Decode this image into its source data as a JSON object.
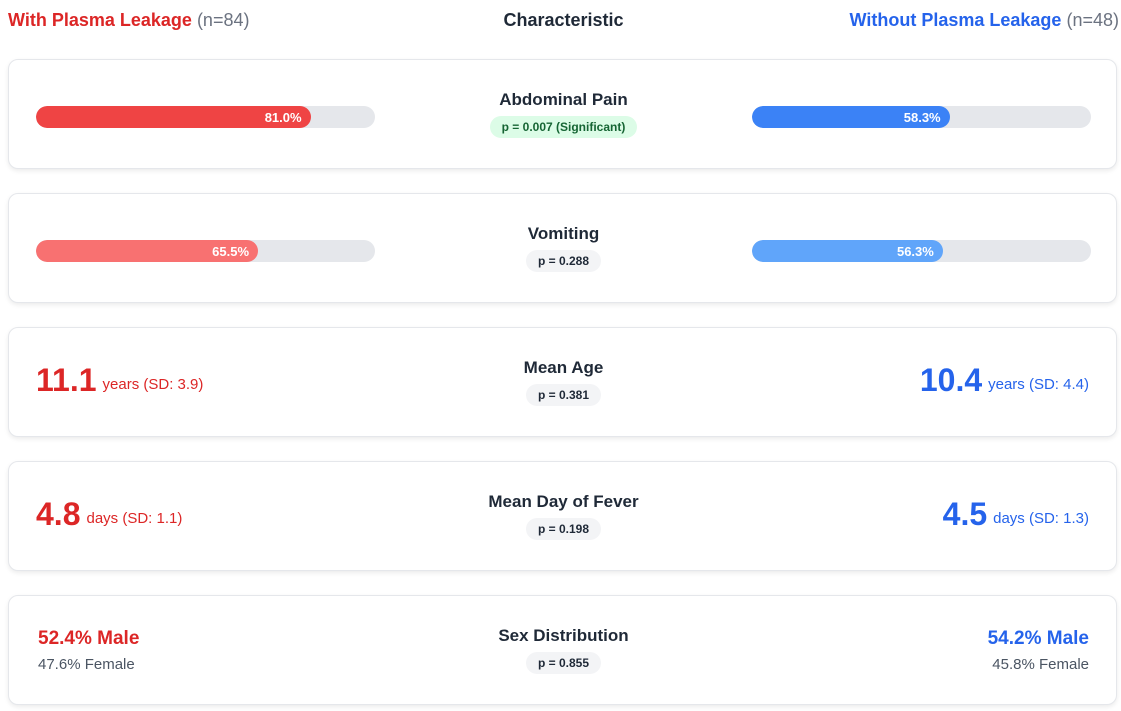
{
  "header": {
    "left_group": "With Plasma Leakage",
    "left_n": "(n=84)",
    "center": "Characteristic",
    "right_group": "Without Plasma Leakage",
    "right_n": "(n=48)"
  },
  "colors": {
    "left_strong": "#ef4444",
    "left_light": "#f87171",
    "left_text": "#dc2626",
    "right_strong": "#3b82f6",
    "right_light": "#60a5fa",
    "right_text": "#2563eb",
    "track": "#e5e7eb",
    "significant_bg": "#dcfce7",
    "neutral_bg": "#f3f4f6"
  },
  "chart_data": {
    "type": "bar",
    "categories": [
      "Abdominal Pain",
      "Vomiting"
    ],
    "series": [
      {
        "name": "With Plasma Leakage",
        "values": [
          81.0,
          65.5
        ]
      },
      {
        "name": "Without Plasma Leakage",
        "values": [
          58.3,
          56.3
        ]
      }
    ],
    "ylim": [
      0,
      100
    ]
  },
  "rows": {
    "abdominal_pain": {
      "label": "Abdominal Pain",
      "p": "p = 0.007 (Significant)",
      "left_value": 81.0,
      "left_text": "81.0%",
      "right_value": 58.3,
      "right_text": "58.3%"
    },
    "vomiting": {
      "label": "Vomiting",
      "p": "p = 0.288",
      "left_value": 65.5,
      "left_text": "65.5%",
      "right_value": 56.3,
      "right_text": "56.3%"
    },
    "mean_age": {
      "label": "Mean Age",
      "p": "p = 0.381",
      "left_big": "11.1",
      "left_small": "years (SD: 3.9)",
      "right_big": "10.4",
      "right_small": "years (SD: 4.4)"
    },
    "mean_fever": {
      "label": "Mean Day of Fever",
      "p": "p = 0.198",
      "left_big": "4.8",
      "left_small": "days (SD: 1.1)",
      "right_big": "4.5",
      "right_small": "days (SD: 1.3)"
    },
    "sex": {
      "label": "Sex Distribution",
      "p": "p = 0.855",
      "left_male": "52.4% Male",
      "left_female": "47.6% Female",
      "right_male": "54.2% Male",
      "right_female": "45.8% Female"
    }
  }
}
